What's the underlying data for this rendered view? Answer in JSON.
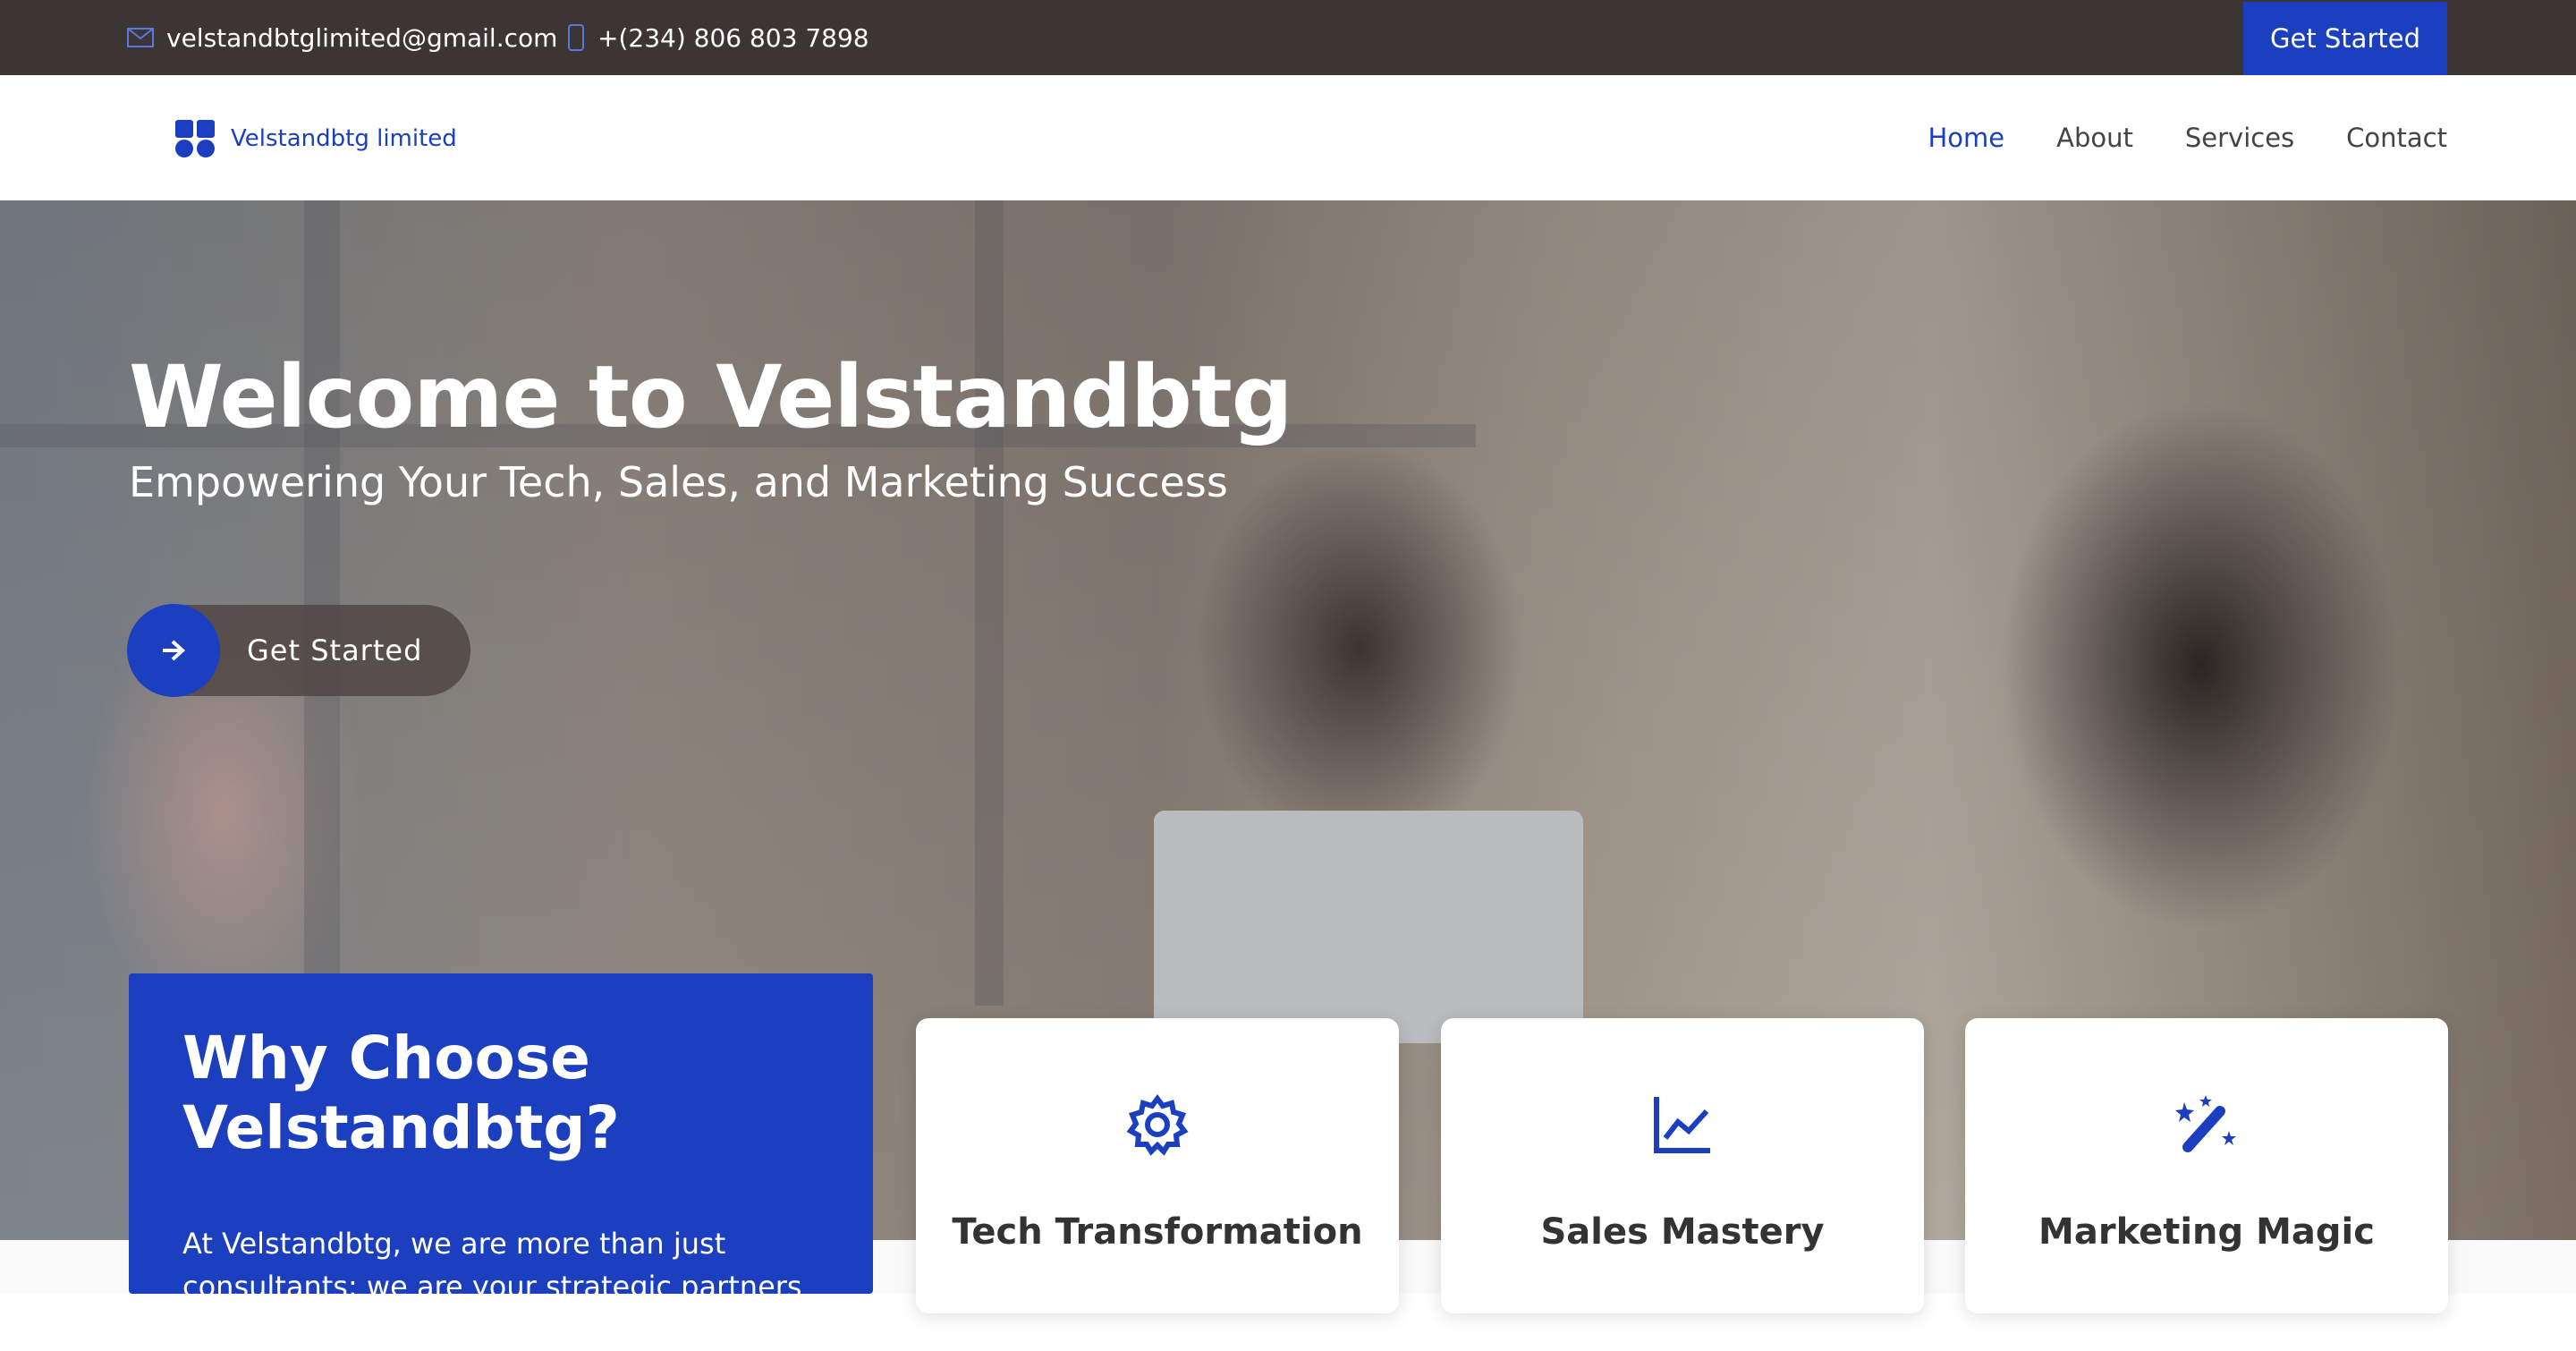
{
  "topbar": {
    "email": "velstandbtglimited@gmail.com",
    "phone": "+(234) 806 803 7898",
    "cta_label": "Get Started"
  },
  "header": {
    "logo_text": "Velstandbtg limited",
    "nav": [
      {
        "label": "Home",
        "active": true
      },
      {
        "label": "About",
        "active": false
      },
      {
        "label": "Services",
        "active": false
      },
      {
        "label": "Contact",
        "active": false
      }
    ]
  },
  "hero": {
    "title": "Welcome to Velstandbtg",
    "subtitle": "Empowering Your Tech, Sales, and Marketing Success",
    "cta_label": "Get Started"
  },
  "why": {
    "title": "Why Choose Velstandbtg?",
    "text": "At Velstandbtg, we are more than just consultants; we are your strategic partners on"
  },
  "cards": [
    {
      "title": "Tech Transformation",
      "icon": "gear-icon"
    },
    {
      "title": "Sales Mastery",
      "icon": "line-chart-icon"
    },
    {
      "title": "Marketing Magic",
      "icon": "magic-wand-icon"
    }
  ],
  "colors": {
    "brand": "#1b3fbf",
    "topbar": "#3d3533"
  }
}
